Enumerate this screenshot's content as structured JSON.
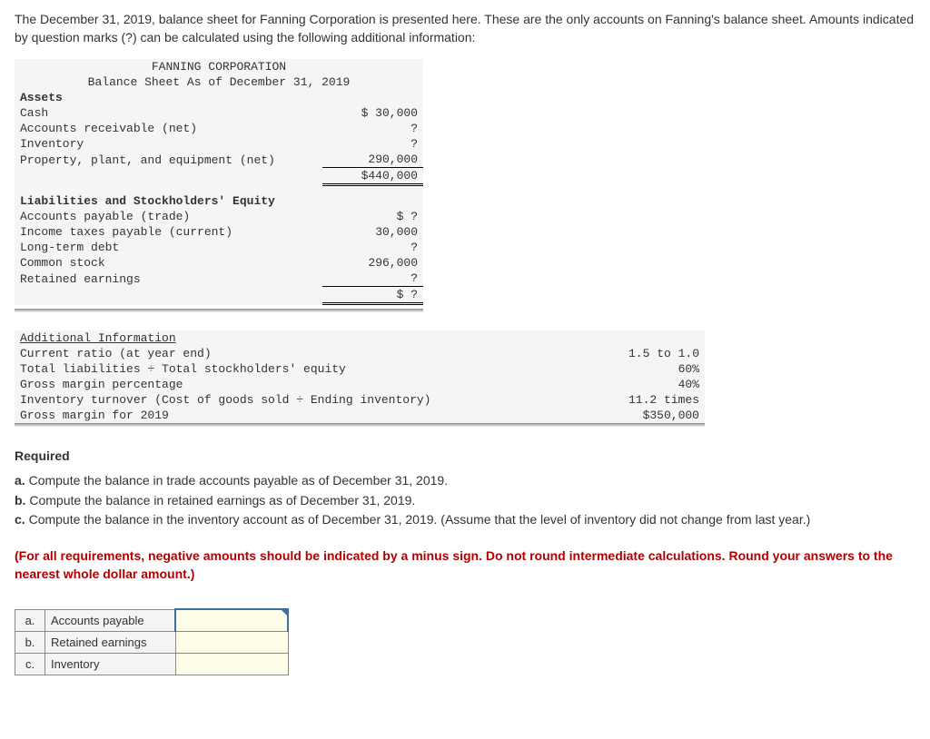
{
  "intro": "The December 31, 2019, balance sheet for Fanning Corporation is presented here. These are the only accounts on Fanning's balance sheet. Amounts indicated by question marks (?) can be calculated using the following additional information:",
  "balanceSheet": {
    "company": "FANNING CORPORATION",
    "title": "Balance Sheet As of December 31, 2019",
    "assetsHeader": "Assets",
    "assets": [
      {
        "label": "Cash",
        "amount": "$ 30,000"
      },
      {
        "label": "Accounts receivable (net)",
        "amount": "?"
      },
      {
        "label": "Inventory",
        "amount": "?"
      },
      {
        "label": "Property, plant, and equipment (net)",
        "amount": "290,000"
      }
    ],
    "assetsTotal": "$440,000",
    "liabHeader": "Liabilities and Stockholders' Equity",
    "liab": [
      {
        "label": "Accounts payable (trade)",
        "amount": "$       ?"
      },
      {
        "label": "Income taxes payable (current)",
        "amount": "30,000"
      },
      {
        "label": "Long-term debt",
        "amount": "?"
      },
      {
        "label": "Common stock",
        "amount": "296,000"
      },
      {
        "label": "Retained earnings",
        "amount": "?"
      }
    ],
    "liabTotal": "$       ?"
  },
  "addl": {
    "title": "Additional Information",
    "rows": [
      {
        "label": "Current ratio (at year end)",
        "value": "1.5 to 1.0"
      },
      {
        "label": "Total liabilities ÷ Total stockholders' equity",
        "value": "60%"
      },
      {
        "label": "Gross margin percentage",
        "value": "40%"
      },
      {
        "label": "Inventory turnover (Cost of goods sold ÷ Ending inventory)",
        "value": "11.2 times"
      },
      {
        "label": "Gross margin for 2019",
        "value": "$350,000"
      }
    ]
  },
  "requiredHeading": "Required",
  "requirements": [
    {
      "marker": "a.",
      "text": "Compute the balance in trade accounts payable as of December 31, 2019."
    },
    {
      "marker": "b.",
      "text": "Compute the balance in retained earnings as of December 31, 2019."
    },
    {
      "marker": "c.",
      "text": "Compute the balance in the inventory account as of December 31, 2019. (Assume that the level of inventory did not change from last year.)"
    }
  ],
  "note": "(For all requirements, negative amounts should be indicated by a minus sign. Do not round intermediate calculations. Round your answers to the nearest whole dollar amount.)",
  "answerRows": [
    {
      "key": "a.",
      "label": "Accounts payable"
    },
    {
      "key": "b.",
      "label": "Retained earnings"
    },
    {
      "key": "c.",
      "label": "Inventory"
    }
  ]
}
